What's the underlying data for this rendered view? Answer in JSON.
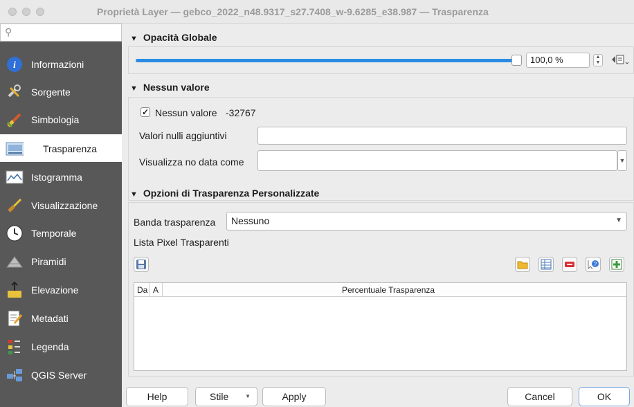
{
  "window": {
    "title": "Proprietà Layer — gebco_2022_n48.9317_s27.7408_w-9.6285_e38.987 — Trasparenza"
  },
  "sidebar": {
    "search_placeholder": "",
    "items": [
      {
        "label": "Informazioni",
        "icon": "info-icon"
      },
      {
        "label": "Sorgente",
        "icon": "tools-icon"
      },
      {
        "label": "Simbologia",
        "icon": "paintbrush-icon"
      },
      {
        "label": "Trasparenza",
        "icon": "transparency-icon"
      },
      {
        "label": "Istogramma",
        "icon": "histogram-icon"
      },
      {
        "label": "Visualizzazione",
        "icon": "brush-icon"
      },
      {
        "label": "Temporale",
        "icon": "clock-icon"
      },
      {
        "label": "Piramidi",
        "icon": "pyramid-icon"
      },
      {
        "label": "Elevazione",
        "icon": "elevation-icon"
      },
      {
        "label": "Metadati",
        "icon": "metadata-icon"
      },
      {
        "label": "Legenda",
        "icon": "legend-icon"
      },
      {
        "label": "QGIS Server",
        "icon": "server-icon"
      }
    ],
    "active_index": 3
  },
  "global_opacity": {
    "header": "Opacità Globale",
    "value_text": "100,0 %",
    "value_fraction": 1.0
  },
  "nodata": {
    "header": "Nessun valore",
    "checkbox_label": "Nessun valore",
    "checkbox_checked": true,
    "nodata_value": "-32767",
    "additional_label": "Valori nulli aggiuntivi",
    "additional_value": "",
    "display_label": "Visualizza no data come",
    "display_value": ""
  },
  "custom_transparency": {
    "header": "Opzioni di Trasparenza Personalizzate",
    "band_label": "Banda trasparenza",
    "band_value": "Nessuno",
    "pixel_list_label": "Lista Pixel Trasparenti",
    "table_headers": [
      "Da",
      "A",
      "Percentuale Trasparenza"
    ],
    "rows": []
  },
  "buttons": {
    "help": "Help",
    "style": "Stile",
    "apply": "Apply",
    "cancel": "Cancel",
    "ok": "OK"
  },
  "colors": {
    "accent": "#2b8ce3",
    "sidebar_bg": "#585858"
  }
}
